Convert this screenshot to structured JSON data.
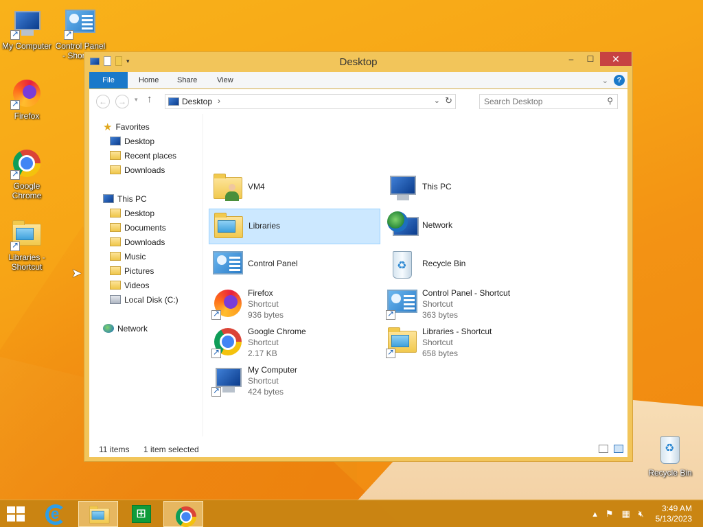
{
  "desktop": {
    "icons": [
      {
        "label": "My Computer"
      },
      {
        "label": "Control Panel - Shortcut"
      },
      {
        "label": "Firefox"
      },
      {
        "label": "Google Chrome"
      },
      {
        "label": "Libraries - Shortcut"
      },
      {
        "label": "Recycle Bin"
      }
    ]
  },
  "window": {
    "title": "Desktop",
    "controls": {
      "minimize": "–",
      "maximize": "☐",
      "close": "✕"
    },
    "ribbon_tabs": [
      "File",
      "Home",
      "Share",
      "View"
    ],
    "address": {
      "location": "Desktop",
      "separator": "›"
    },
    "search": {
      "placeholder": "Search Desktop"
    },
    "nav_pane": {
      "favorites": {
        "label": "Favorites",
        "items": [
          "Desktop",
          "Recent places",
          "Downloads"
        ]
      },
      "this_pc": {
        "label": "This PC",
        "items": [
          "Desktop",
          "Documents",
          "Downloads",
          "Music",
          "Pictures",
          "Videos",
          "Local Disk (C:)"
        ]
      },
      "network": {
        "label": "Network"
      }
    },
    "items": [
      {
        "name": "VM4",
        "type": "",
        "size": ""
      },
      {
        "name": "This PC",
        "type": "",
        "size": ""
      },
      {
        "name": "Libraries",
        "type": "",
        "size": ""
      },
      {
        "name": "Network",
        "type": "",
        "size": ""
      },
      {
        "name": "Control Panel",
        "type": "",
        "size": ""
      },
      {
        "name": "Recycle Bin",
        "type": "",
        "size": ""
      },
      {
        "name": "Firefox",
        "type": "Shortcut",
        "size": "936 bytes"
      },
      {
        "name": "Control Panel - Shortcut",
        "type": "Shortcut",
        "size": "363 bytes"
      },
      {
        "name": "Google Chrome",
        "type": "Shortcut",
        "size": "2.17 KB"
      },
      {
        "name": "Libraries - Shortcut",
        "type": "Shortcut",
        "size": "658 bytes"
      },
      {
        "name": "My Computer",
        "type": "Shortcut",
        "size": "424 bytes"
      }
    ],
    "status": {
      "count": "11 items",
      "selection": "1 item selected"
    }
  },
  "taskbar": {
    "clock": {
      "time": "3:49 AM",
      "date": "5/13/2023"
    }
  },
  "colors": {
    "accent": "#1979ca",
    "selection": "#cce8ff",
    "close": "#c74242"
  }
}
